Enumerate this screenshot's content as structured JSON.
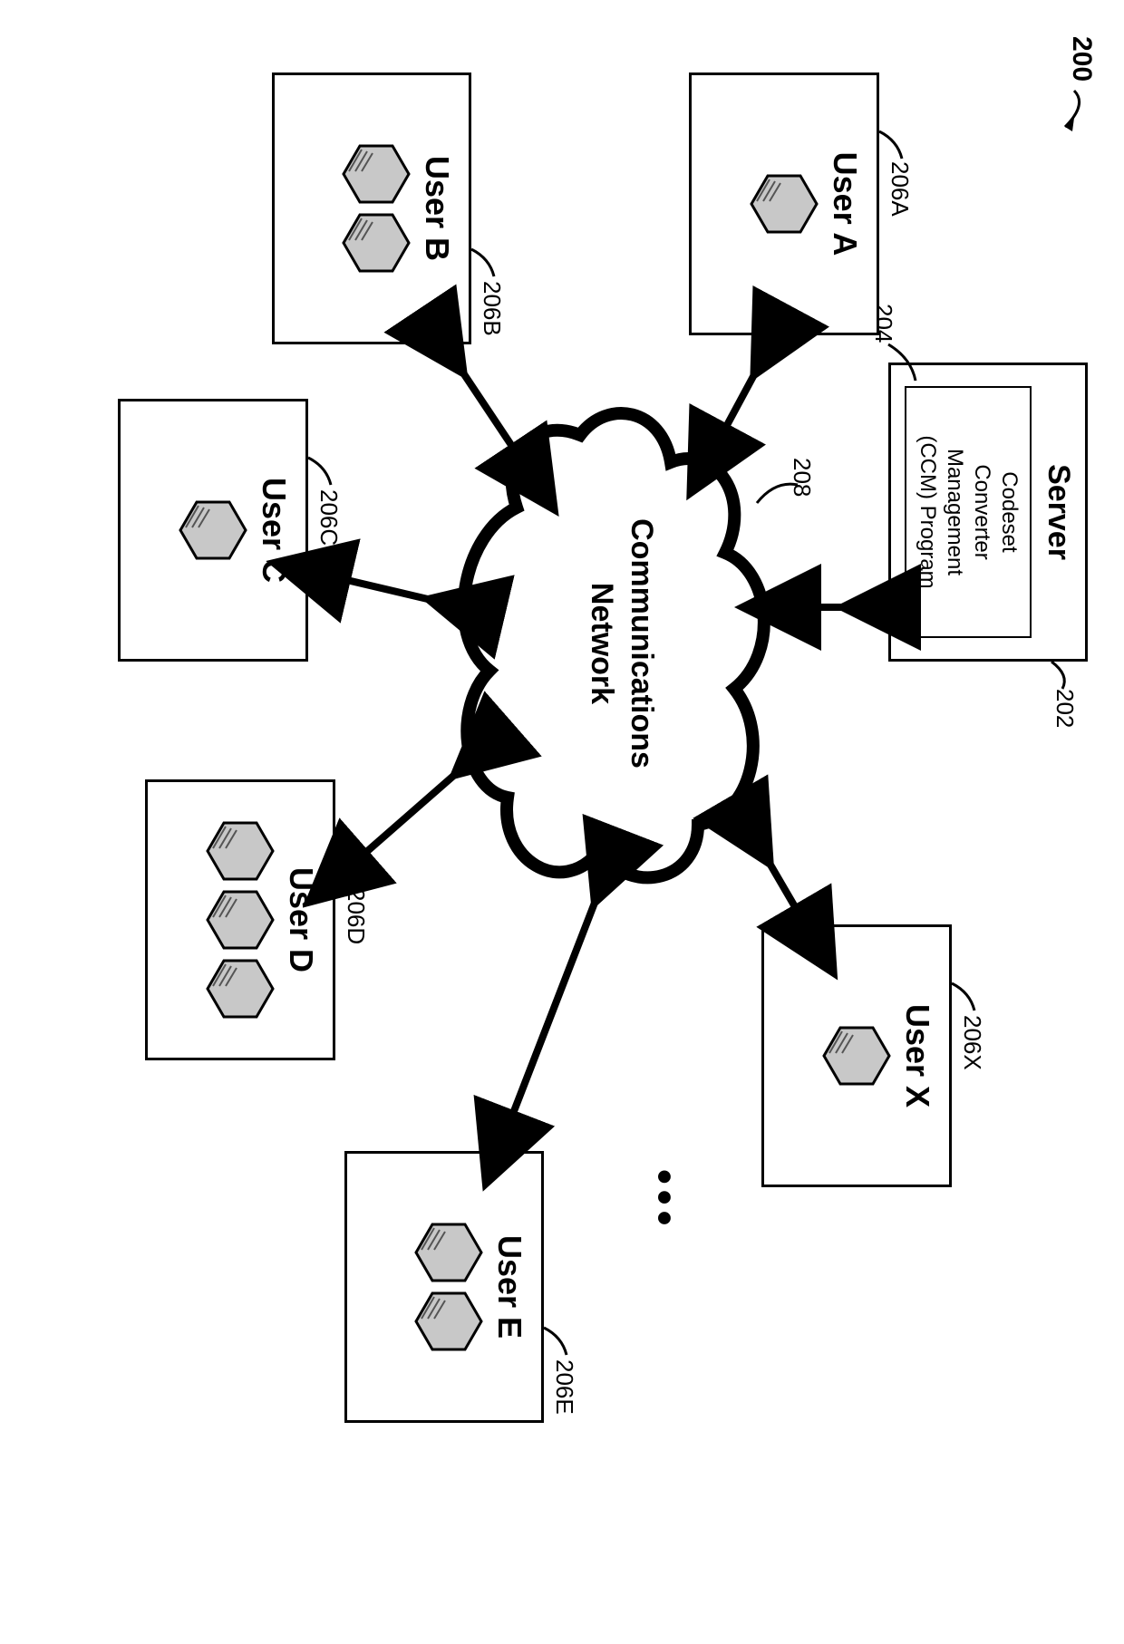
{
  "figure_ref": "200",
  "server": {
    "title": "Server",
    "ref": "202",
    "program": {
      "lines": [
        "Codeset",
        "Converter",
        "Management",
        "(CCM) Program"
      ],
      "ref": "204"
    }
  },
  "cloud": {
    "label_line1": "Communications",
    "label_line2": "Network",
    "ref": "208"
  },
  "ellipsis": "•••",
  "users": {
    "a": {
      "label": "User A",
      "ref": "206A",
      "hex_count": 1
    },
    "b": {
      "label": "User B",
      "ref": "206B",
      "hex_count": 2
    },
    "c": {
      "label": "User C",
      "ref": "206C",
      "hex_count": 1
    },
    "d": {
      "label": "User D",
      "ref": "206D",
      "hex_count": 3
    },
    "e": {
      "label": "User E",
      "ref": "206E",
      "hex_count": 2
    },
    "x": {
      "label": "User X",
      "ref": "206X",
      "hex_count": 1
    }
  }
}
